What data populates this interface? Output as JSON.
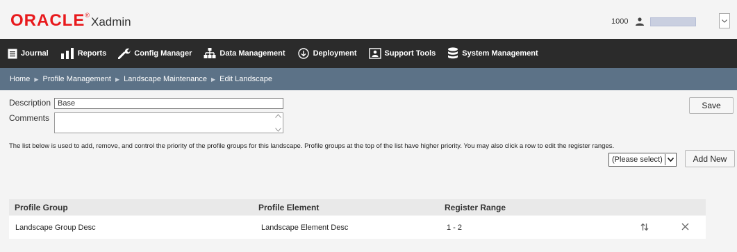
{
  "brand": {
    "logo_text": "ORACLE",
    "app_name": "Xadmin",
    "accent": "#e8191c"
  },
  "user": {
    "store_number": "1000"
  },
  "nav": {
    "items": [
      {
        "label": "Journal",
        "icon": "journal-icon"
      },
      {
        "label": "Reports",
        "icon": "reports-icon"
      },
      {
        "label": "Config Manager",
        "icon": "wrench-icon"
      },
      {
        "label": "Data Management",
        "icon": "hierarchy-icon"
      },
      {
        "label": "Deployment",
        "icon": "cloud-download-icon"
      },
      {
        "label": "Support Tools",
        "icon": "support-icon"
      },
      {
        "label": "System Management",
        "icon": "database-icon"
      }
    ]
  },
  "breadcrumb": [
    "Home",
    "Profile Management",
    "Landscape Maintenance",
    "Edit Landscape"
  ],
  "form": {
    "description_label": "Description",
    "description_value": "Base",
    "comments_label": "Comments",
    "comments_value": "",
    "save_label": "Save"
  },
  "info_text": "The list below is used to add, remove, and control the priority of the profile groups for this landscape. Profile groups at the top of the list have higher priority. You may also click a row to edit the register ranges.",
  "add": {
    "select_value": "(Please select)",
    "button_label": "Add New"
  },
  "table": {
    "headers": [
      "Profile Group",
      "Profile Element",
      "Register Range"
    ],
    "rows": [
      {
        "group": "Landscape Group Desc",
        "element": "Landscape Element Desc",
        "range": "1 - 2"
      }
    ]
  }
}
